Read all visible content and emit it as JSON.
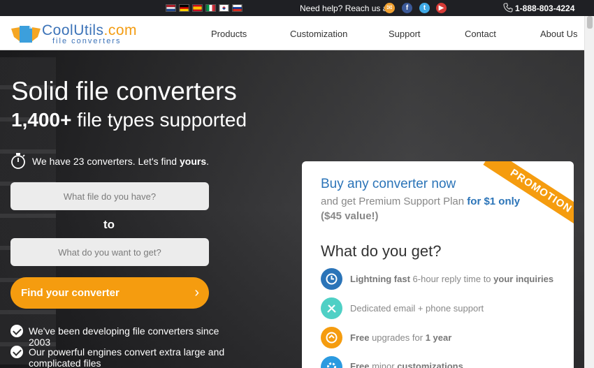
{
  "topbar": {
    "help_text": "Need help? Reach us at",
    "phone": "1-888-803-4224",
    "flags": [
      "nl-flag",
      "de-flag",
      "es-flag",
      "it-flag",
      "kr-flag",
      "ru-flag"
    ],
    "social": [
      "email-icon",
      "facebook-icon",
      "twitter-icon",
      "youtube-icon"
    ]
  },
  "header": {
    "logo_main": "CoolUtils",
    "logo_tld": ".com",
    "logo_sub": "file converters",
    "nav": [
      "Products",
      "Customization",
      "Support",
      "Contact",
      "About Us"
    ]
  },
  "hero": {
    "title": "Solid file converters",
    "subtitle_bold": "1,400+",
    "subtitle_rest": "file types supported",
    "find_text_pre": "We have 23 converters. Let's find ",
    "find_text_bold": "yours",
    "find_text_post": ".",
    "input_from_placeholder": "What file do you have?",
    "to_label": "to",
    "input_to_placeholder": "What do you want to get?",
    "find_button": "Find your converter",
    "bullets": [
      "We've been developing file converters since 2003",
      "Our powerful engines convert extra large and complicated files"
    ]
  },
  "promo": {
    "ribbon": "PROMOTION",
    "headline": "Buy any converter now",
    "sub_pre": "and get Premium Support Plan ",
    "sub_bold": "for $1 only",
    "sub_value": "($45 value!)",
    "what_title": "What do you get?",
    "features": [
      {
        "bold": "Lightning fast",
        "text": " 6-hour reply time to ",
        "bold2": "your inquiries",
        "icon": "clock-icon",
        "color": "#2b74b8"
      },
      {
        "bold": "",
        "text": "Dedicated email + phone support",
        "bold2": "",
        "icon": "tools-icon",
        "color": "#4fd0c5"
      },
      {
        "bold": "Free",
        "text": " upgrades for ",
        "bold2": "1 year",
        "icon": "upgrade-icon",
        "color": "#f59c0f"
      },
      {
        "bold": "Free",
        "text": " minor ",
        "bold2": "customizations",
        "icon": "gear-icon",
        "color": "#2b9ae0"
      }
    ]
  },
  "colors": {
    "accent": "#f59c0f",
    "brand_blue": "#2b74b8",
    "topbar": "#1f2024"
  }
}
